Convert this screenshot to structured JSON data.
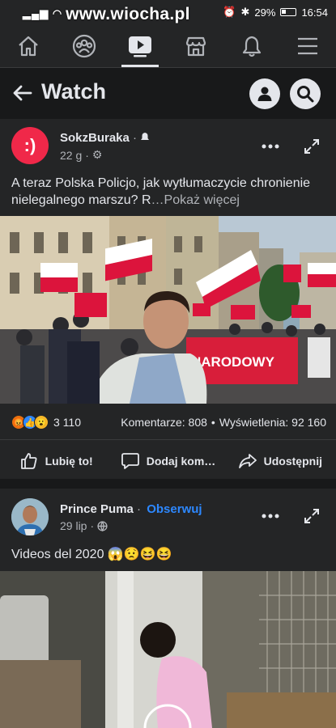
{
  "status_bar": {
    "watermark": "www.wiocha.pl",
    "battery": "29%",
    "time": "16:54"
  },
  "nav": {
    "tabs": [
      {
        "icon": "home-icon"
      },
      {
        "icon": "groups-icon"
      },
      {
        "icon": "watch-icon",
        "active": true
      },
      {
        "icon": "marketplace-icon"
      },
      {
        "icon": "bell-icon"
      },
      {
        "icon": "menu-icon"
      }
    ]
  },
  "header": {
    "title": "Watch"
  },
  "post1": {
    "author": "SokzBuraka",
    "time": "22 g",
    "text": "A teraz Polska Policjo, jak wytłumaczycie chronienie nielegalnego marszu? R",
    "more": "…Pokaż więcej",
    "banner_text": "NARODOWY",
    "reaction_count": "3 110",
    "comments": "Komentarze: 808",
    "views": "Wyświetlenia: 92 160",
    "like_label": "Lubię to!",
    "comment_label": "Dodaj kom…",
    "share_label": "Udostępnij"
  },
  "post2": {
    "author": "Prince Puma",
    "follow": "Obserwuj",
    "time": "29 lip",
    "text": "Videos del 2020 😱😟😆😆"
  },
  "colors": {
    "background": "#18191a",
    "card": "#242526",
    "accent": "#2d88ff",
    "avatar1": "#f02849",
    "flag_red": "#dc143c"
  }
}
